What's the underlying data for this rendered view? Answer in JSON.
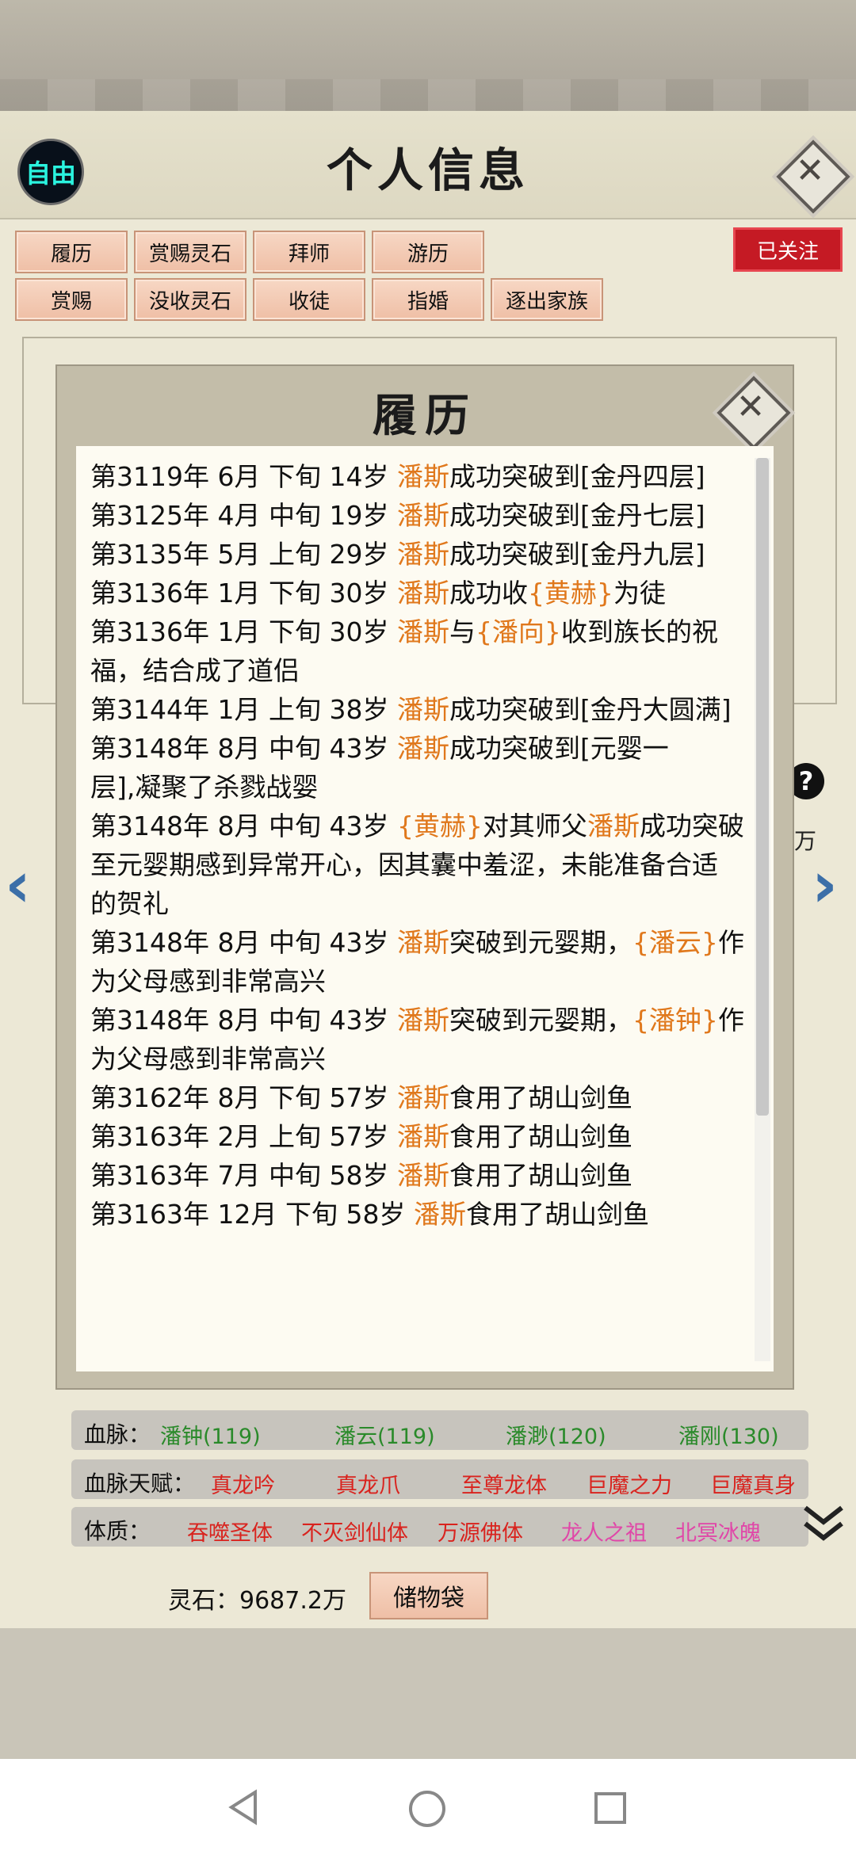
{
  "header": {
    "free_label": "自由",
    "title": "个人信息"
  },
  "actions": {
    "row1": [
      "履历",
      "赏赐灵石",
      "拜师",
      "游历"
    ],
    "row2": [
      "赏赐",
      "没收灵石",
      "收徒",
      "指婚",
      "逐出家族"
    ],
    "follow_label": "已关注"
  },
  "sidebar_right": {
    "help": "?",
    "unit": "万"
  },
  "bloodline": {
    "label": "血脉：",
    "items": [
      "潘钟(119)",
      "潘云(119)",
      "潘渺(120)",
      "潘刚(130)"
    ]
  },
  "bloodline_talent": {
    "label": "血脉天赋：",
    "items": [
      "真龙吟",
      "真龙爪",
      "至尊龙体",
      "巨魔之力",
      "巨魔真身"
    ]
  },
  "physique": {
    "label": "体质：",
    "items": [
      "吞噬圣体",
      "不灭剑仙体",
      "万源佛体",
      "龙人之祖",
      "北冥冰魄"
    ]
  },
  "footer": {
    "spirit_stone": "灵石：9687.2万",
    "storage_label": "储物袋"
  },
  "modal": {
    "title": "履历",
    "lines": [
      {
        "a": "第3119年 6月 下旬  14岁 ",
        "n": "潘斯",
        "b": "成功突破到[金丹四层]"
      },
      {
        "a": "第3125年 4月 中旬  19岁 ",
        "n": "潘斯",
        "b": "成功突破到[金丹七层]"
      },
      {
        "a": "第3135年 5月 上旬  29岁 ",
        "n": "潘斯",
        "b": "成功突破到[金丹九层]"
      },
      {
        "a": "第3136年 1月 下旬  30岁 ",
        "n": "潘斯",
        "b": "成功收",
        "n2": "{黄赫}",
        "c": "为徒"
      },
      {
        "a": "第3136年 1月 下旬  30岁 ",
        "n": "潘斯",
        "b": "与",
        "n2": "{潘向}",
        "c": "收到族长的祝"
      },
      {
        "a": "福，结合成了道侣"
      },
      {
        "a": "第3144年 1月 上旬 38岁 ",
        "n": "潘斯",
        "b": "成功突破到[金丹大圆满]"
      },
      {
        "a": "第3148年  8月  中旬   43岁   ",
        "n": "潘斯",
        "b": "成功突破到[元婴一"
      },
      {
        "a": "层],凝聚了杀戮战婴"
      },
      {
        "a": "第3148年 8月 中旬 43岁 ",
        "n": "{黄赫}",
        "b": "对其师父",
        "n2": "潘斯",
        "c": "成功突破"
      },
      {
        "a": "至元婴期感到异常开心，因其囊中羞涩，未能准备合适"
      },
      {
        "a": "的贺礼"
      },
      {
        "a": "第3148年 8月 中旬 43岁 ",
        "n": "潘斯",
        "b": "突破到元婴期，",
        "n2": "{潘云}",
        "c": "作"
      },
      {
        "a": "为父母感到非常高兴"
      },
      {
        "a": "第3148年 8月 中旬 43岁 ",
        "n": "潘斯",
        "b": "突破到元婴期，",
        "n2": "{潘钟}",
        "c": "作"
      },
      {
        "a": "为父母感到非常高兴"
      },
      {
        "a": "第3162年 8月 下旬  57岁 ",
        "n": "潘斯",
        "b": "食用了胡山剑鱼"
      },
      {
        "a": "第3163年 2月 上旬  57岁 ",
        "n": "潘斯",
        "b": "食用了胡山剑鱼"
      },
      {
        "a": "第3163年 7月 中旬  58岁 ",
        "n": "潘斯",
        "b": "食用了胡山剑鱼"
      },
      {
        "a": "第3163年 12月 下旬  58岁  ",
        "n": "潘斯",
        "b": "食用了胡山剑鱼"
      }
    ]
  }
}
